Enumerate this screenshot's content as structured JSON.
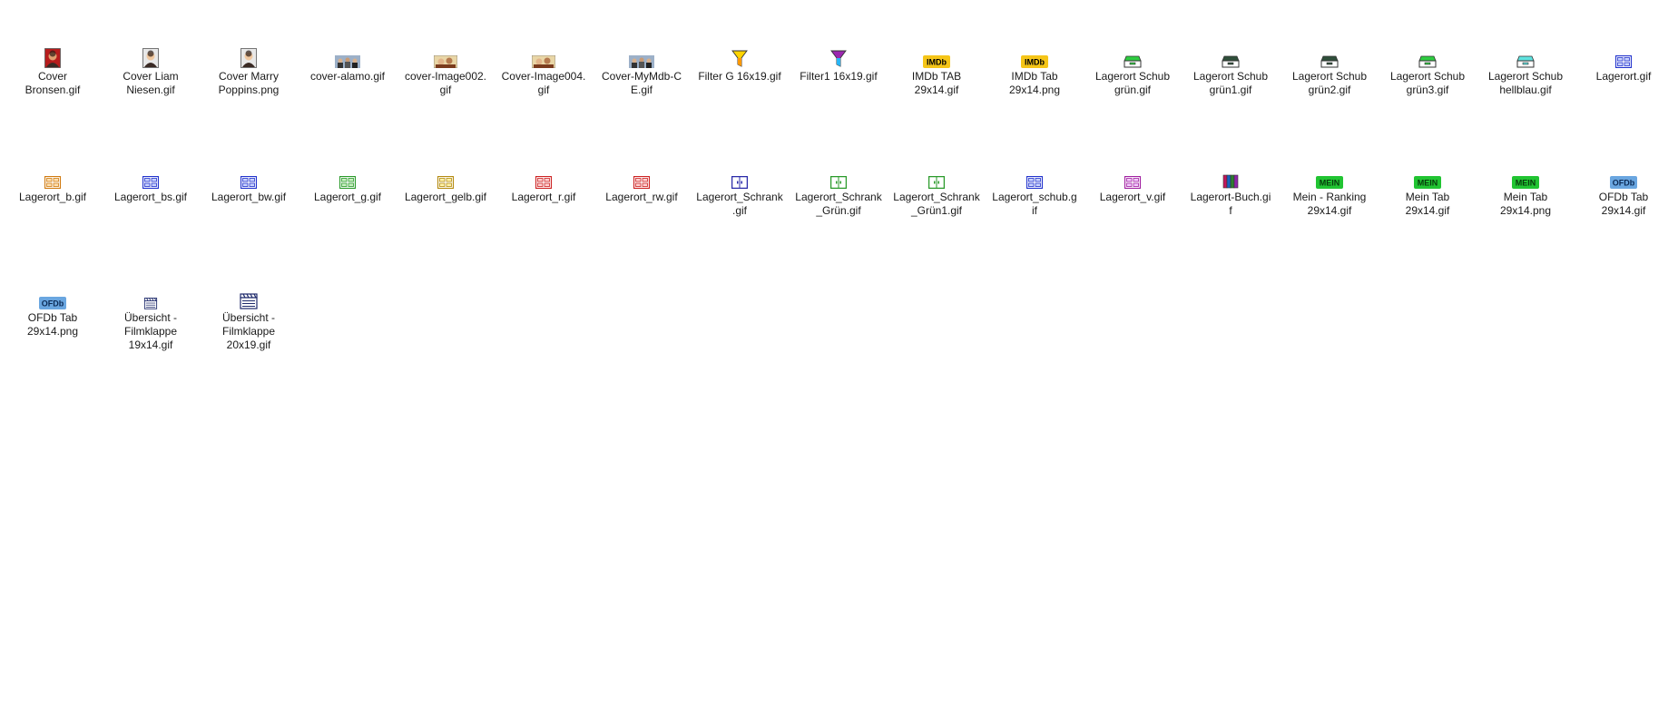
{
  "files": [
    {
      "label": "Cover\nBronsen.gif",
      "icon": "cover-portrait-red-icon"
    },
    {
      "label": "Cover Liam\nNiesen.gif",
      "icon": "cover-portrait-icon"
    },
    {
      "label": "Cover Marry\nPoppins.png",
      "icon": "cover-portrait-icon"
    },
    {
      "label": "cover-alamo.gif",
      "icon": "cover-group-icon"
    },
    {
      "label": "cover-Image002.\ngif",
      "icon": "cover-image-icon"
    },
    {
      "label": "Cover-Image004.\ngif",
      "icon": "cover-image-icon"
    },
    {
      "label": "Cover-MyMdb-C\nE.gif",
      "icon": "cover-group-icon"
    },
    {
      "label": "Filter G 16x19.gif",
      "icon": "filter-yellow-icon"
    },
    {
      "label": "Filter1 16x19.gif",
      "icon": "filter-blue-icon"
    },
    {
      "label": "IMDb TAB\n29x14.gif",
      "icon": "imdb-tab-icon"
    },
    {
      "label": "IMDb Tab\n29x14.png",
      "icon": "imdb-tab-icon"
    },
    {
      "label": "Lagerort Schub\ngrün.gif",
      "icon": "drawer-green-icon"
    },
    {
      "label": "Lagerort Schub\ngrün1.gif",
      "icon": "drawer-dark-icon"
    },
    {
      "label": "Lagerort Schub\ngrün2.gif",
      "icon": "drawer-dark-icon"
    },
    {
      "label": "Lagerort Schub\ngrün3.gif",
      "icon": "drawer-green-icon"
    },
    {
      "label": "Lagerort Schub\nhellblau.gif",
      "icon": "drawer-lightblue-icon"
    },
    {
      "label": "Lagerort.gif",
      "icon": "cabinet-blue-icon"
    },
    {
      "label": "Lagerort_b.gif",
      "icon": "cabinet-orange-icon"
    },
    {
      "label": "Lagerort_bs.gif",
      "icon": "cabinet-blue-icon"
    },
    {
      "label": "Lagerort_bw.gif",
      "icon": "cabinet-blue-icon"
    },
    {
      "label": "Lagerort_g.gif",
      "icon": "cabinet-green-icon"
    },
    {
      "label": "Lagerort_gelb.gif",
      "icon": "cabinet-yellow-icon"
    },
    {
      "label": "Lagerort_r.gif",
      "icon": "cabinet-red-icon"
    },
    {
      "label": "Lagerort_rw.gif",
      "icon": "cabinet-red-icon"
    },
    {
      "label": "Lagerort_Schrank\n.gif",
      "icon": "cabinet-doors-blue-icon"
    },
    {
      "label": "Lagerort_Schrank\n_Grün.gif",
      "icon": "cabinet-doors-green-icon"
    },
    {
      "label": "Lagerort_Schrank\n_Grün1.gif",
      "icon": "cabinet-doors-green-icon"
    },
    {
      "label": "Lagerort_schub.g\nif",
      "icon": "cabinet-blue-icon"
    },
    {
      "label": "Lagerort_v.gif",
      "icon": "cabinet-purple-icon"
    },
    {
      "label": "Lagerort-Buch.gi\nf",
      "icon": "books-icon"
    },
    {
      "label": "Mein - Ranking\n29x14.gif",
      "icon": "mein-tab-icon"
    },
    {
      "label": "Mein Tab\n29x14.gif",
      "icon": "mein-tab-icon"
    },
    {
      "label": "Mein Tab\n29x14.png",
      "icon": "mein-tab-icon"
    },
    {
      "label": "OFDb Tab\n29x14.gif",
      "icon": "ofdb-tab-icon"
    },
    {
      "label": "OFDb Tab\n29x14.png",
      "icon": "ofdb-tab-icon"
    },
    {
      "label": "Übersicht -\nFilmklappe\n19x14.gif",
      "icon": "clapperboard-icon"
    },
    {
      "label": "Übersicht -\nFilmklappe\n20x19.gif",
      "icon": "clapperboard-icon"
    }
  ],
  "badges": {
    "imdb": "IMDb",
    "mein": "MEIN",
    "ofdb": "OFDb"
  },
  "colors": {
    "imdb": "#f5c518",
    "mein": "#21c432",
    "ofdb": "#6aa6e0"
  }
}
